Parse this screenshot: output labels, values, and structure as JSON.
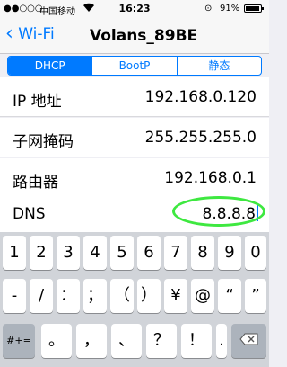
{
  "status_bar": {
    "signal": "●●○○○",
    "carrier": "中国移动",
    "time": "16:23",
    "lock_icon": "orientation-lock-icon",
    "battery_pct": "91%"
  },
  "nav": {
    "back_label": "Wi-Fi",
    "title": "Volans_89BE"
  },
  "segments": [
    "DHCP",
    "BootP",
    "静态"
  ],
  "rows": [
    {
      "label": "IP 地址",
      "value": "192.168.0.120"
    },
    {
      "label": "子网掩码",
      "value": "255.255.255.0"
    },
    {
      "label": "路由器",
      "value": "192.168.0.1"
    },
    {
      "label": "DNS",
      "value": "8.8.8.8"
    }
  ],
  "keyboard": {
    "row1": [
      "1",
      "2",
      "3",
      "4",
      "5",
      "6",
      "7",
      "8",
      "9",
      "0"
    ],
    "row2": [
      "-",
      "/",
      "：",
      "；",
      "（",
      "）",
      "¥",
      "@",
      "“",
      "”"
    ],
    "row3_left": "#+=",
    "row3_mid": [
      "。",
      "，",
      "、",
      "？",
      "！",
      "."
    ],
    "delete_icon": "backspace-icon"
  },
  "colors": {
    "accent": "#007aff",
    "highlight": "#3ee840"
  }
}
